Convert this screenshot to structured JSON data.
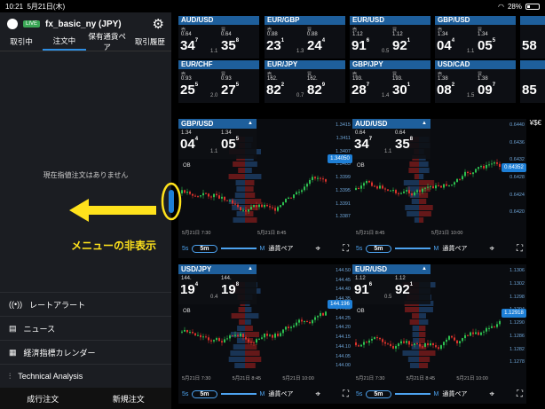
{
  "status": {
    "time": "10:21",
    "date": "5月21日(木)",
    "battery": "28%",
    "battery_level": 0.28
  },
  "sidebar": {
    "live_badge": "LIVE",
    "account": "fx_basic_ny (JPY)",
    "tabs": [
      "取引中",
      "注文中",
      "保有通貨ペア",
      "取引履歴"
    ],
    "active_tab": 1,
    "empty_message": "現在指値注文はありません",
    "menu": [
      {
        "icon": "broadcast-icon",
        "label": "レートアラート"
      },
      {
        "icon": "news-icon",
        "label": "ニュース"
      },
      {
        "icon": "calendar-icon",
        "label": "経済指標カレンダー"
      },
      {
        "icon": "analysis-icon",
        "label": "Technical Analysis"
      }
    ],
    "footer": [
      "成行注文",
      "新規注文"
    ],
    "annotation": "メニューの非表示"
  },
  "tiles": [
    {
      "pair": "AUD/USD",
      "sell_label": "売",
      "buy_label": "買",
      "sell_pre": "0.64",
      "sell_big": "34",
      "sell_sup": "7",
      "spread": "1.1",
      "buy_pre": "0.64",
      "buy_big": "35",
      "buy_sup": "8"
    },
    {
      "pair": "EUR/GBP",
      "sell_label": "売",
      "buy_label": "買",
      "sell_pre": "0.88",
      "sell_big": "23",
      "sell_sup": "1",
      "spread": "1.3",
      "buy_pre": "0.88",
      "buy_big": "24",
      "buy_sup": "4"
    },
    {
      "pair": "EUR/USD",
      "sell_label": "売",
      "buy_label": "買",
      "sell_pre": "1.12",
      "sell_big": "91",
      "sell_sup": "6",
      "spread": "0.5",
      "buy_pre": "1.12",
      "buy_big": "92",
      "buy_sup": "1"
    },
    {
      "pair": "GBP/USD",
      "sell_label": "売",
      "buy_label": "買",
      "sell_pre": "1.34",
      "sell_big": "04",
      "sell_sup": "4",
      "spread": "1.1",
      "buy_pre": "1.34",
      "buy_big": "05",
      "buy_sup": "5"
    },
    {
      "pair": "EUR/CHF",
      "sell_label": "売",
      "buy_label": "買",
      "sell_pre": "0.93",
      "sell_big": "25",
      "sell_sup": "5",
      "spread": "2.0",
      "buy_pre": "0.93",
      "buy_big": "27",
      "buy_sup": "5"
    },
    {
      "pair": "EUR/JPY",
      "sell_label": "売",
      "buy_label": "買",
      "sell_pre": "162.",
      "sell_big": "82",
      "sell_sup": "2",
      "spread": "0.7",
      "buy_pre": "162.",
      "buy_big": "82",
      "buy_sup": "9"
    },
    {
      "pair": "GBP/JPY",
      "sell_label": "売",
      "buy_label": "買",
      "sell_pre": "193.",
      "sell_big": "28",
      "sell_sup": "7",
      "spread": "1.4",
      "buy_pre": "193.",
      "buy_big": "30",
      "buy_sup": "1"
    },
    {
      "pair": "USD/CAD",
      "sell_label": "売",
      "buy_label": "買",
      "sell_pre": "1.38",
      "sell_big": "08",
      "sell_sup": "2",
      "spread": "1.5",
      "buy_pre": "1.38",
      "buy_big": "09",
      "buy_sup": "7"
    }
  ],
  "tile_partial": {
    "tile0": "58",
    "tile1": "85"
  },
  "charts": [
    {
      "pair": "GBP/USD",
      "sell_pre": "1.34",
      "sell_big": "04",
      "sell_sup": "4",
      "spread": "1.1",
      "buy_pre": "1.34",
      "buy_big": "05",
      "buy_sup": "5",
      "ob": "OB",
      "y": [
        "1.3415",
        "1.3411",
        "1.3407",
        "1.3403",
        "1.3399",
        "1.3395",
        "1.3391",
        "1.3387"
      ],
      "price": "1.34050",
      "x": [
        "5月21日 7:30",
        "5月21日 8:45"
      ],
      "tf": "5m",
      "tf_s": "5s",
      "tf_m": "M",
      "pair_label": "通貨ペア"
    },
    {
      "pair": "AUD/USD",
      "sell_pre": "0.64",
      "sell_big": "34",
      "sell_sup": "7",
      "spread": "1.1",
      "buy_pre": "0.64",
      "buy_big": "35",
      "buy_sup": "8",
      "ob": "OB",
      "y": [
        "0.6440",
        "0.6436",
        "0.6432",
        "0.6428",
        "0.6424",
        "0.6420"
      ],
      "price": "0.64352",
      "x": [
        "5月21日 8:45",
        "5月21日 10:00"
      ],
      "tf": "5m",
      "tf_s": "5s",
      "tf_m": "M",
      "pair_label": "通貨ペア"
    },
    {
      "pair": "USD/JPY",
      "sell_pre": "144.",
      "sell_big": "19",
      "sell_sup": "4",
      "spread": "0.4",
      "buy_pre": "144.",
      "buy_big": "19",
      "buy_sup": "8",
      "ob": "OB",
      "y": [
        "144.50",
        "144.45",
        "144.40",
        "144.35",
        "144.30",
        "144.25",
        "144.20",
        "144.15",
        "144.10",
        "144.05",
        "144.00"
      ],
      "price": "144.196",
      "x": [
        "5月21日 7:30",
        "5月21日 8:45",
        "5月21日 10:00"
      ],
      "tf": "5m",
      "tf_s": "5s",
      "tf_m": "M",
      "pair_label": "通貨ペア"
    },
    {
      "pair": "EUR/USD",
      "sell_pre": "1.12",
      "sell_big": "91",
      "sell_sup": "6",
      "spread": "0.5",
      "buy_pre": "1.12",
      "buy_big": "92",
      "buy_sup": "1",
      "ob": "OB",
      "y": [
        "1.1306",
        "1.1302",
        "1.1298",
        "1.1294",
        "1.1290",
        "1.1286",
        "1.1282",
        "1.1278"
      ],
      "price": "1.12918",
      "x": [
        "5月21日 7:30",
        "5月21日 8:45",
        "5月21日 10:00"
      ],
      "tf": "5m",
      "tf_s": "5s",
      "tf_m": "M",
      "pair_label": "通貨ペア"
    }
  ],
  "currency_icon": "¥$€",
  "colors": {
    "accent": "#1e5f9c",
    "up": "#2dbf4f",
    "down": "#d9322b",
    "price_tag": "#1e7fd6",
    "annotation": "#ffe21c"
  }
}
